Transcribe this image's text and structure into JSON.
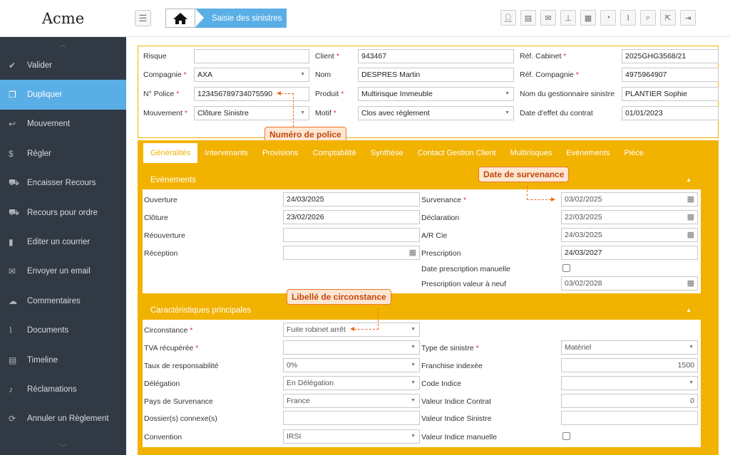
{
  "app": {
    "logo": "Acme"
  },
  "breadcrumb": {
    "current": "Saisie des sinistres"
  },
  "toolbar_icons": [
    "user-icon",
    "clipboard-icon",
    "mail-icon",
    "pin-icon",
    "calendar-icon",
    "dashboard-icon",
    "paperclip-icon",
    "search-icon",
    "share-icon",
    "logout-icon"
  ],
  "sidebar": {
    "items": [
      {
        "label": "Valider",
        "icon": "check-circle-icon",
        "glyph": "✔"
      },
      {
        "label": "Dupliquer",
        "icon": "copy-icon",
        "glyph": "❐",
        "active": true
      },
      {
        "label": "Mouvement",
        "icon": "reply-icon",
        "glyph": "↩"
      },
      {
        "label": "Régler",
        "icon": "dollar-icon",
        "glyph": "$"
      },
      {
        "label": "Encaisser Recours",
        "icon": "cart-icon",
        "glyph": "⛟"
      },
      {
        "label": "Recours pour ordre",
        "icon": "cart-icon",
        "glyph": "⛟"
      },
      {
        "label": "Editer un courrier",
        "icon": "file-icon",
        "glyph": "▮"
      },
      {
        "label": "Envoyer un email",
        "icon": "envelope-icon",
        "glyph": "✉"
      },
      {
        "label": "Commentaires",
        "icon": "comments-icon",
        "glyph": "☁"
      },
      {
        "label": "Documents",
        "icon": "paperclip-icon",
        "glyph": "⌇"
      },
      {
        "label": "Timeline",
        "icon": "film-icon",
        "glyph": "▤"
      },
      {
        "label": "Réclamations",
        "icon": "bell-icon",
        "glyph": "♪"
      },
      {
        "label": "Annuler un Règlement",
        "icon": "refresh-icon",
        "glyph": "⟳"
      }
    ]
  },
  "header_form": {
    "risque": {
      "label": "Risque",
      "value": ""
    },
    "compagnie": {
      "label": "Compagnie",
      "value": "AXA"
    },
    "police": {
      "label": "N° Police",
      "value": "123456789734075590"
    },
    "mouvement": {
      "label": "Mouvement",
      "value": "Clôture Sinistre"
    },
    "client": {
      "label": "Client",
      "value": "943467"
    },
    "nom": {
      "label": "Nom",
      "value": "DESPRES Martin"
    },
    "produit": {
      "label": "Produit",
      "value": "Multirisque Immeuble"
    },
    "motif": {
      "label": "Motif",
      "value": "Clos avec règlement"
    },
    "ref_cabinet": {
      "label": "Réf. Cabinet",
      "value": "2025GHG3568/21"
    },
    "ref_compagnie": {
      "label": "Réf. Compagnie",
      "value": "4975964907"
    },
    "gestionnaire": {
      "label": "Nom du gestionnaire sinistre",
      "value": "PLANTIER Sophie"
    },
    "date_effet": {
      "label": "Date d'effet du contrat",
      "value": "01/01/2023"
    }
  },
  "tabs": [
    "Généralités",
    "Intervenants",
    "Provisions",
    "Comptabilité",
    "Synthèse",
    "Contact Gestion Client",
    "Multirisques",
    "Evènements",
    "Pièce"
  ],
  "evenements": {
    "title": "Evénements",
    "ouverture": {
      "label": "Ouverture",
      "value": "24/03/2025"
    },
    "cloture": {
      "label": "Clôture",
      "value": "23/02/2026"
    },
    "reouverture": {
      "label": "Réouverture",
      "value": ""
    },
    "reception": {
      "label": "Réception",
      "value": ""
    },
    "survenance": {
      "label": "Survenance",
      "value": "03/02/2025"
    },
    "declaration": {
      "label": "Déclaration",
      "value": "22/03/2025"
    },
    "ar_cie": {
      "label": "A/R Cie",
      "value": "24/03/2025"
    },
    "prescription": {
      "label": "Prescription",
      "value": "24/03/2027"
    },
    "date_prescription_manuelle": {
      "label": "Date prescription manuelle"
    },
    "prescription_neuf": {
      "label": "Prescription valeur à neuf",
      "value": "03/02/2028"
    }
  },
  "caracteristiques": {
    "title": "Caractéristiques principales",
    "circonstance": {
      "label": "Circonstance",
      "value": "Fuite robinet arrêt"
    },
    "tva": {
      "label": "TVA récupérée",
      "value": ""
    },
    "taux": {
      "label": "Taux de responsabilité",
      "value": "0%"
    },
    "delegation": {
      "label": "Délégation",
      "value": "En Délégation"
    },
    "pays": {
      "label": "Pays de Survenance",
      "value": "France"
    },
    "dossiers": {
      "label": "Dossier(s) connexe(s)",
      "value": ""
    },
    "convention": {
      "label": "Convention",
      "value": "IRSI"
    },
    "type_sinistre": {
      "label": "Type de sinistre",
      "value": "Matériel"
    },
    "franchise": {
      "label": "Franchise indexée",
      "value": "1500"
    },
    "code_indice": {
      "label": "Code Indice",
      "value": ""
    },
    "valeur_contrat": {
      "label": "Valeur Indice Contrat",
      "value": "0"
    },
    "valeur_sinistre": {
      "label": "Valeur Indice Sinistre",
      "value": ""
    },
    "valeur_manuelle": {
      "label": "Valeur Indice manuelle"
    }
  },
  "callouts": {
    "police": "Numéro de police",
    "survenance": "Date de survenance",
    "circonstance": "Libellé de circonstance"
  }
}
